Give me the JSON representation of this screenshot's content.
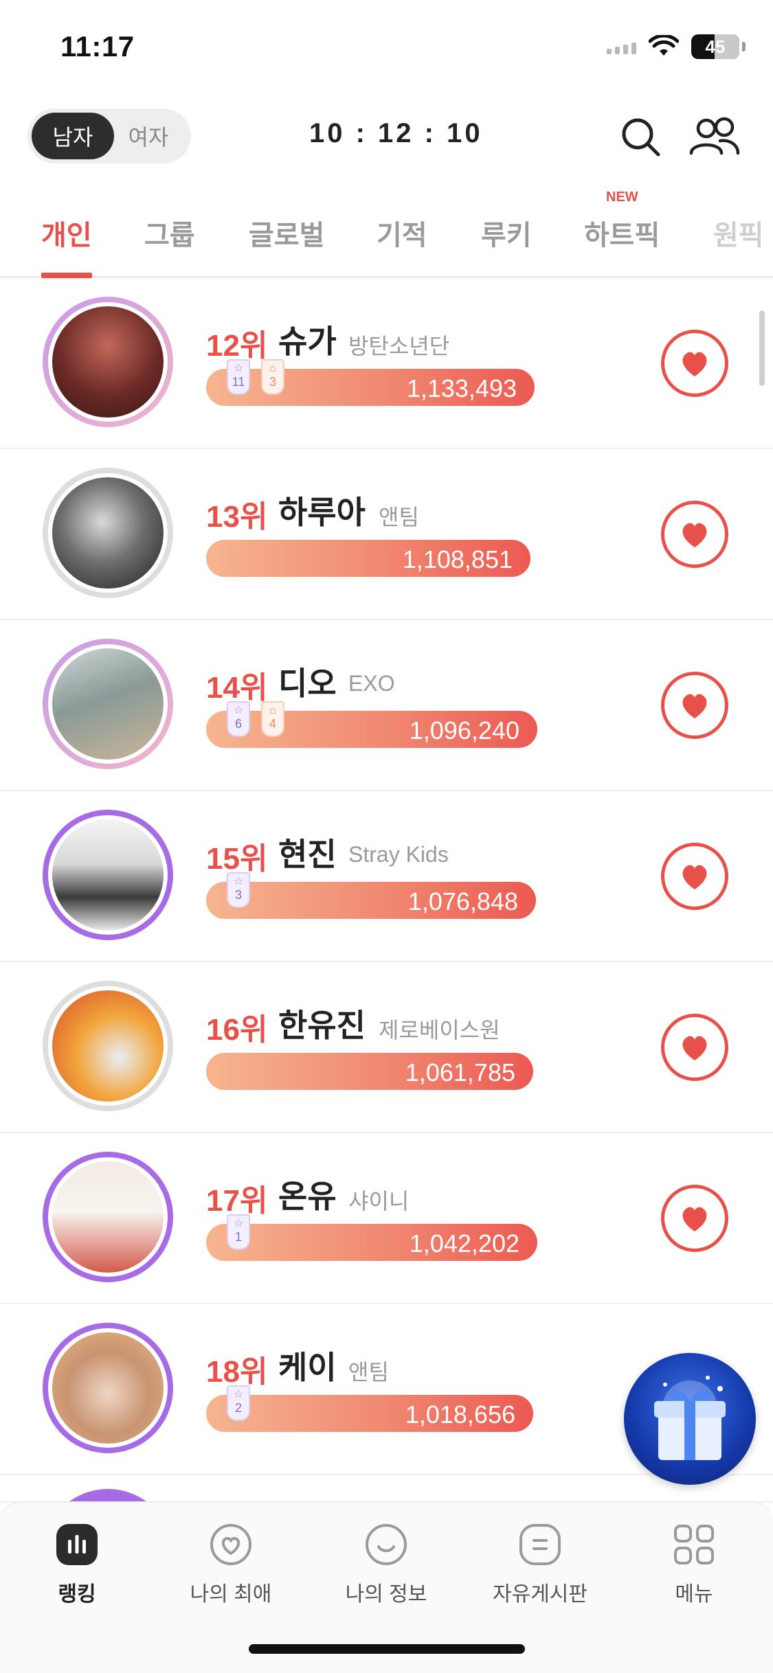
{
  "status_bar": {
    "time": "11:17",
    "battery": "45"
  },
  "header": {
    "gender": {
      "male": "남자",
      "female": "여자",
      "selected": "남자"
    },
    "timer": "10 : 12 : 10",
    "icons": [
      "search-icon",
      "friends-icon"
    ]
  },
  "tabs": {
    "items": [
      "개인",
      "그룹",
      "글로벌",
      "기적",
      "루키",
      "하트픽",
      "원픽"
    ],
    "active": "개인",
    "new_badge": "NEW"
  },
  "rankings": [
    {
      "rank": "12위",
      "name": "슈가",
      "group": "방탄소년단",
      "votes": "1,133,493",
      "badges": [
        {
          "icon": "star",
          "count": "11"
        },
        {
          "icon": "bag",
          "count": "3"
        }
      ],
      "ring": "pink"
    },
    {
      "rank": "13위",
      "name": "하루아",
      "group": "앤팀",
      "votes": "1,108,851",
      "badges": [],
      "ring": "gray"
    },
    {
      "rank": "14위",
      "name": "디오",
      "group": "EXO",
      "votes": "1,096,240",
      "badges": [
        {
          "icon": "star",
          "count": "6"
        },
        {
          "icon": "bag",
          "count": "4"
        }
      ],
      "ring": "pink"
    },
    {
      "rank": "15위",
      "name": "현진",
      "group": "Stray Kids",
      "votes": "1,076,848",
      "badges": [
        {
          "icon": "star",
          "count": "3"
        }
      ],
      "ring": "purple"
    },
    {
      "rank": "16위",
      "name": "한유진",
      "group": "제로베이스원",
      "votes": "1,061,785",
      "badges": [],
      "ring": "gray"
    },
    {
      "rank": "17위",
      "name": "온유",
      "group": "샤이니",
      "votes": "1,042,202",
      "badges": [
        {
          "icon": "star",
          "count": "1"
        }
      ],
      "ring": "purple"
    },
    {
      "rank": "18위",
      "name": "케이",
      "group": "앤팀",
      "votes": "1,018,656",
      "badges": [
        {
          "icon": "star",
          "count": "2"
        }
      ],
      "ring": "purple"
    }
  ],
  "bottom_nav": {
    "items": [
      {
        "label": "랭킹",
        "icon": "chart-icon",
        "active": true
      },
      {
        "label": "나의 최애",
        "icon": "heart-outline-icon",
        "active": false
      },
      {
        "label": "나의 정보",
        "icon": "smile-icon",
        "active": false
      },
      {
        "label": "자유게시판",
        "icon": "board-icon",
        "active": false
      },
      {
        "label": "메뉴",
        "icon": "menu-grid-icon",
        "active": false
      }
    ]
  },
  "colors": {
    "accent": "#e8514a",
    "purple": "#a86be6",
    "pink": "#e2a9c9",
    "gray": "#dedede"
  }
}
